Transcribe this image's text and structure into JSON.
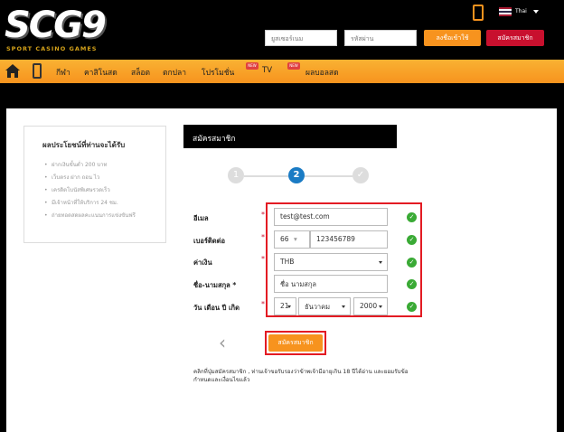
{
  "header": {
    "logo_text": "SCG9",
    "logo_subtitle": "SPORT CASINO GAMES",
    "language": "Thai",
    "username_placeholder": "ยูสเซอร์เนม",
    "password_placeholder": "รหัสผ่าน",
    "login_label": "ลงชื่อเข้าใช้",
    "register_label": "สมัครสมาชิก"
  },
  "nav": {
    "items": [
      "กีฬา",
      "คาสิโนสด",
      "สล็อต",
      "ตกปลา",
      "โปรโมชั่น",
      "TV",
      "ผลบอลสด"
    ],
    "badge": "NEW"
  },
  "benefits": {
    "title": "ผลประโยชน์ที่ท่านจะได้รับ",
    "items": [
      "ฝากเงินขั้นต่ำ 200 บาท",
      "เว็บตรง ฝาก ถอน ไว",
      "เครดิตโบนัสพิเศษรวดเร็ว",
      "มีเจ้าหน้าที่ให้บริการ 24 ชม.",
      "ถ่ายทอดสดผลคะแนนการแข่งขันฟรี"
    ]
  },
  "form": {
    "title": "สมัครสมาชิก",
    "steps": [
      "1",
      "2",
      "✓"
    ],
    "labels": {
      "email": "อีเมล",
      "phone": "เบอร์ติดต่อ",
      "currency": "ค่าเงิน",
      "name": "ชื่อ-นามสกุล *",
      "dob": "วัน เดือน ปี เกิด"
    },
    "values": {
      "email": "test@test.com",
      "phone_code": "66",
      "phone": "123456789",
      "currency": "THB",
      "name": "ชื่อ นามสกุล",
      "day": "21",
      "month": "ธันวาคม",
      "year": "2000"
    },
    "submit_label": "สมัครสมาชิก",
    "disclaimer": "คลิกที่ปุ่มสมัครสมาชิก , ท่านเจ้าขอรับรองว่าข้าพเจ้ามีอายุเกิน 18 ปีได้อ่าน และยอมรับข้อกำหนดและเงื่อนไขแล้ว"
  },
  "colors": {
    "accent": "#f7931e",
    "register": "#c8102e",
    "step_active": "#1a7bc4",
    "check": "#3aaa35",
    "highlight": "#e31b23"
  }
}
